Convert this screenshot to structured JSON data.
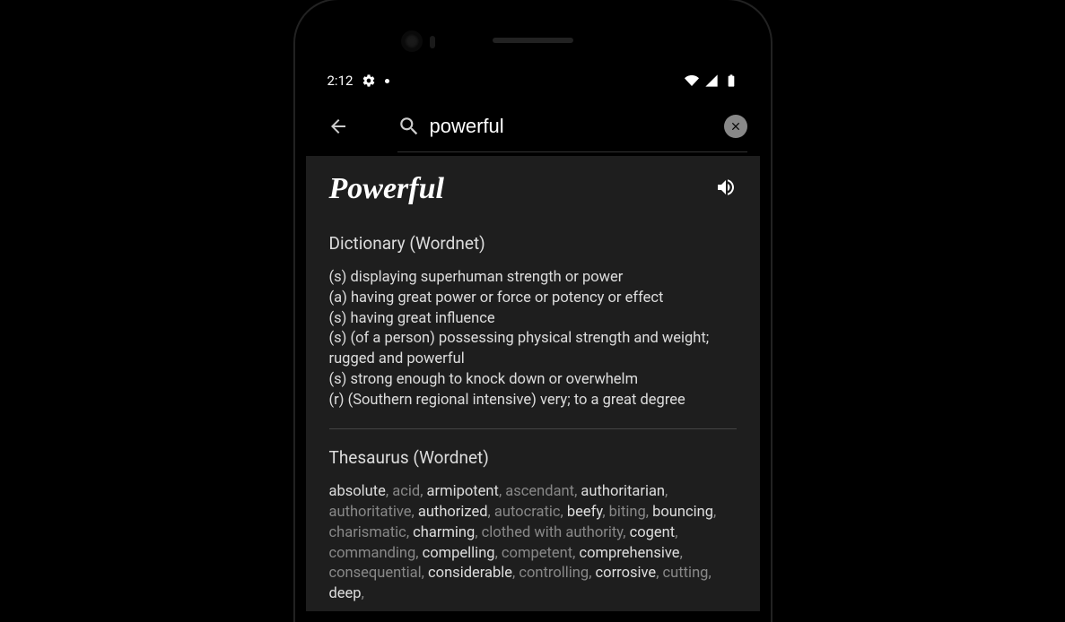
{
  "status": {
    "time": "2:12",
    "icons": [
      "gear-icon",
      "dot-icon"
    ],
    "right": [
      "wifi-icon",
      "signal-icon",
      "battery-icon"
    ]
  },
  "search": {
    "value": "powerful",
    "placeholder": "Search"
  },
  "word": {
    "title": "Powerful"
  },
  "dictionary": {
    "heading": "Dictionary (Wordnet)",
    "entries": [
      "(s) displaying superhuman strength or power",
      "(a) having great power or force or potency or effect",
      "(s) having great influence",
      "(s) (of a person) possessing physical strength and weight; rugged and powerful",
      "(s) strong enough to knock down or overwhelm",
      "(r) (Southern regional intensive) very; to a great degree"
    ]
  },
  "thesaurus": {
    "heading": "Thesaurus (Wordnet)",
    "synonyms": [
      {
        "w": "absolute",
        "d": false
      },
      {
        "w": "acid",
        "d": true
      },
      {
        "w": "armipotent",
        "d": false
      },
      {
        "w": "ascendant",
        "d": true
      },
      {
        "w": "authoritarian",
        "d": false
      },
      {
        "w": "authoritative",
        "d": true
      },
      {
        "w": "authorized",
        "d": false
      },
      {
        "w": "autocratic",
        "d": true
      },
      {
        "w": "beefy",
        "d": false
      },
      {
        "w": "biting",
        "d": true
      },
      {
        "w": "bouncing",
        "d": false
      },
      {
        "w": "charismatic",
        "d": true
      },
      {
        "w": "charming",
        "d": false
      },
      {
        "w": "clothed with authority",
        "d": true
      },
      {
        "w": "cogent",
        "d": false
      },
      {
        "w": "commanding",
        "d": true
      },
      {
        "w": "compelling",
        "d": false
      },
      {
        "w": "competent",
        "d": true
      },
      {
        "w": "comprehensive",
        "d": false
      },
      {
        "w": "consequential",
        "d": true
      },
      {
        "w": "considerable",
        "d": false
      },
      {
        "w": "controlling",
        "d": true
      },
      {
        "w": "corrosive",
        "d": false
      },
      {
        "w": "cutting",
        "d": true
      },
      {
        "w": "deep",
        "d": false
      }
    ]
  }
}
